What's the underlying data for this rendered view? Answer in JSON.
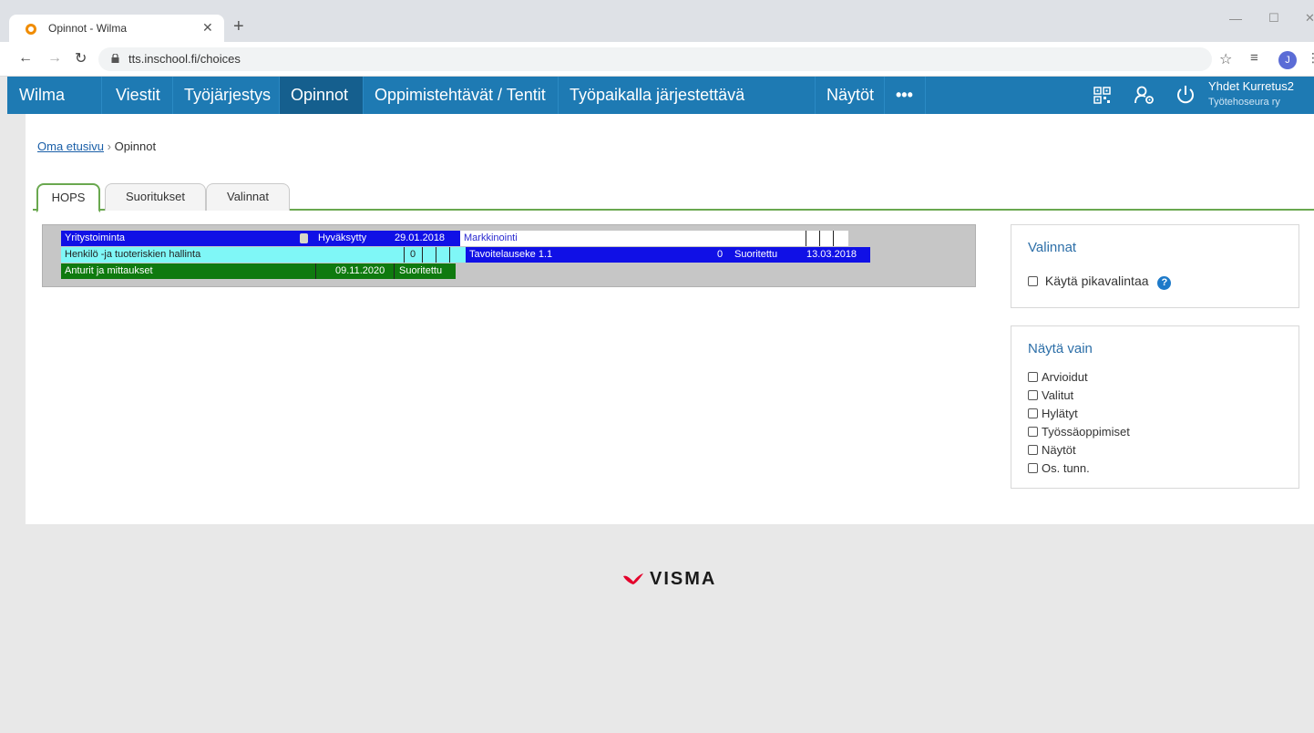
{
  "browser": {
    "tab_title": "Opinnot - Wilma",
    "url": "tts.inschool.fi/choices",
    "profile_initial": "J"
  },
  "wilma_nav": {
    "brand": "Wilma",
    "items": [
      "Viestit",
      "Työjärjestys",
      "Opinnot",
      "Oppimistehtävät / Tentit",
      "Työpaikalla järjestettävä koulutus",
      "Näytöt"
    ],
    "more": "•••",
    "active": "Opinnot",
    "user_name": "Yhdet Kurretus2",
    "user_org": "Työtehoseura ry"
  },
  "breadcrumb": {
    "home": "Oma etusivu",
    "separator": "›",
    "current": "Opinnot"
  },
  "tabs": [
    "HOPS",
    "Suoritukset",
    "Valinnat"
  ],
  "hops": {
    "row1": {
      "course": "Yritystoiminta",
      "status": "Hyväksytty",
      "date": "29.01.2018",
      "next_course": "Markkinointi"
    },
    "row2": {
      "course": "Henkilö -ja tuoteriskien hallinta",
      "count": "0",
      "next_course": "Tavoitelauseke 1.1",
      "next_count": "0",
      "next_status": "Suoritettu",
      "next_date": "13.03.2018"
    },
    "row3": {
      "course": "Anturit ja mittaukset",
      "date": "09.11.2020",
      "status": "Suoritettu"
    },
    "colors": {
      "blue": "#1010e6",
      "cyan": "#7ff7f7",
      "green": "#0f7a0f"
    }
  },
  "valinnat_box": {
    "title": "Valinnat",
    "quick_select_label": "Käytä pikavalintaa",
    "help": "?"
  },
  "filter_box": {
    "title": "Näytä vain",
    "items": [
      "Arvioidut",
      "Valitut",
      "Hylätyt",
      "Työssäoppimiset",
      "Näytöt",
      "Os. tunn."
    ]
  },
  "footer": {
    "logo_text": "VISMA"
  }
}
